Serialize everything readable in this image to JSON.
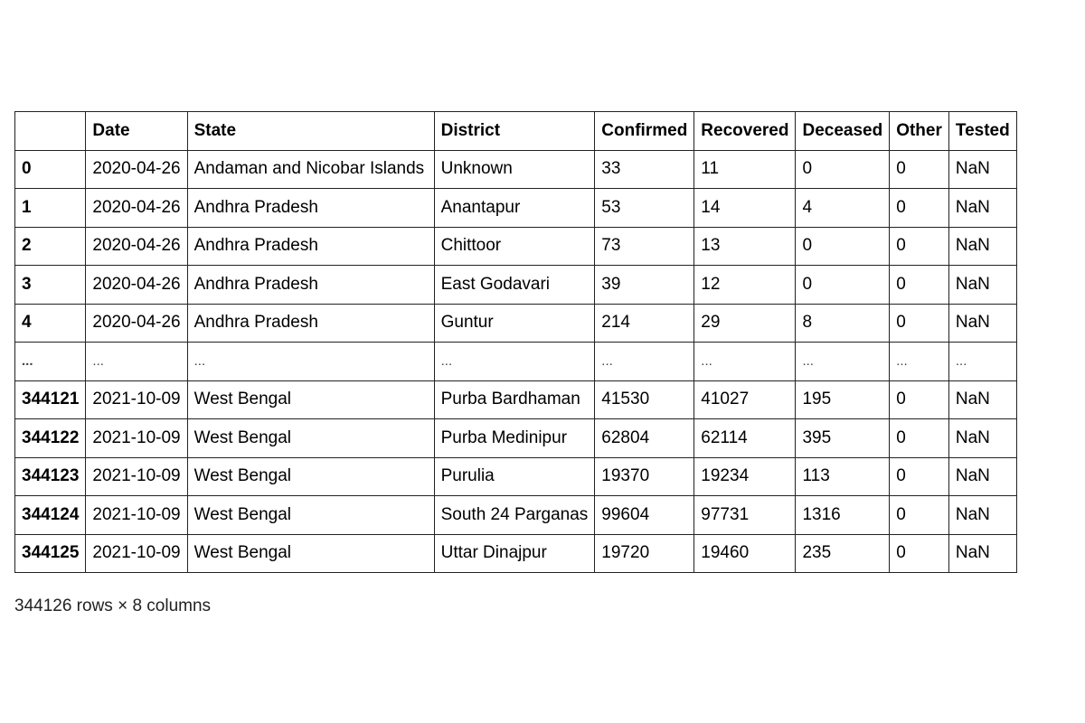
{
  "table": {
    "columns": [
      "",
      "Date",
      "State",
      "District",
      "Confirmed",
      "Recovered",
      "Deceased",
      "Other",
      "Tested"
    ],
    "rows": [
      {
        "index": "0",
        "cells": [
          "2020-04-26",
          "Andaman and Nicobar Islands",
          "Unknown",
          "33",
          "11",
          "0",
          "0",
          "NaN"
        ]
      },
      {
        "index": "1",
        "cells": [
          "2020-04-26",
          "Andhra Pradesh",
          "Anantapur",
          "53",
          "14",
          "4",
          "0",
          "NaN"
        ]
      },
      {
        "index": "2",
        "cells": [
          "2020-04-26",
          "Andhra Pradesh",
          "Chittoor",
          "73",
          "13",
          "0",
          "0",
          "NaN"
        ]
      },
      {
        "index": "3",
        "cells": [
          "2020-04-26",
          "Andhra Pradesh",
          "East Godavari",
          "39",
          "12",
          "0",
          "0",
          "NaN"
        ]
      },
      {
        "index": "4",
        "cells": [
          "2020-04-26",
          "Andhra Pradesh",
          "Guntur",
          "214",
          "29",
          "8",
          "0",
          "NaN"
        ]
      },
      {
        "index": "...",
        "cells": [
          "...",
          "...",
          "...",
          "...",
          "...",
          "...",
          "...",
          "..."
        ],
        "ellipsis": true
      },
      {
        "index": "344121",
        "cells": [
          "2021-10-09",
          "West Bengal",
          "Purba Bardhaman",
          "41530",
          "41027",
          "195",
          "0",
          "NaN"
        ]
      },
      {
        "index": "344122",
        "cells": [
          "2021-10-09",
          "West Bengal",
          "Purba Medinipur",
          "62804",
          "62114",
          "395",
          "0",
          "NaN"
        ]
      },
      {
        "index": "344123",
        "cells": [
          "2021-10-09",
          "West Bengal",
          "Purulia",
          "19370",
          "19234",
          "113",
          "0",
          "NaN"
        ]
      },
      {
        "index": "344124",
        "cells": [
          "2021-10-09",
          "West Bengal",
          "South 24 Parganas",
          "99604",
          "97731",
          "1316",
          "0",
          "NaN"
        ]
      },
      {
        "index": "344125",
        "cells": [
          "2021-10-09",
          "West Bengal",
          "Uttar Dinajpur",
          "19720",
          "19460",
          "235",
          "0",
          "NaN"
        ]
      }
    ]
  },
  "summary": "344126 rows × 8 columns"
}
